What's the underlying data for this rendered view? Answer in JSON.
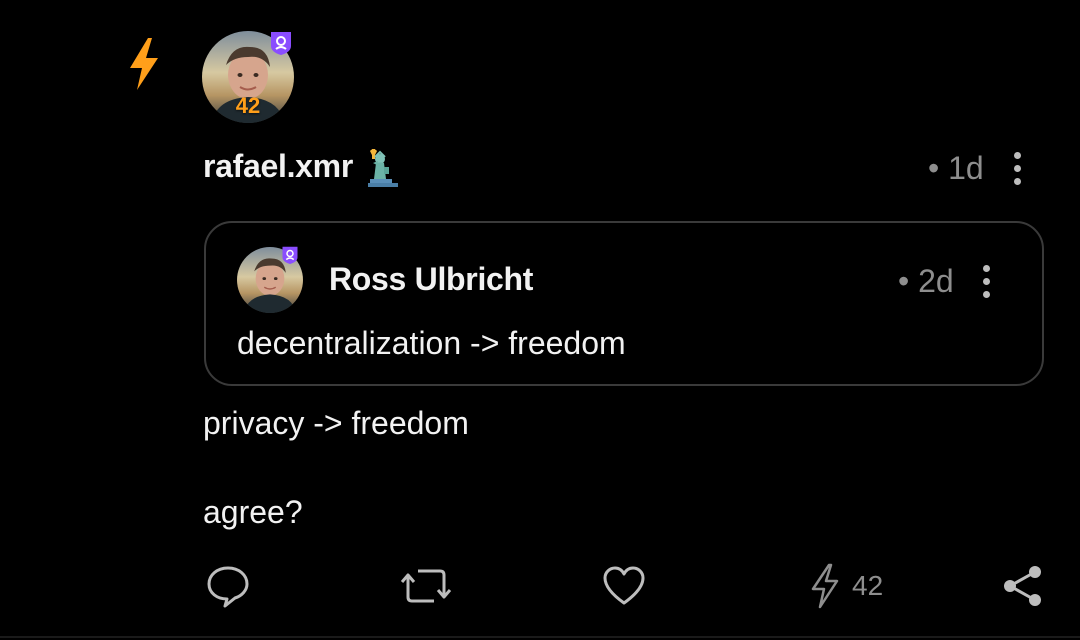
{
  "post": {
    "author": "rafael.xmr",
    "author_emoji": "statue-of-liberty",
    "time": "• 1d",
    "zap_total_badge": "42",
    "lines": [
      "privacy -> freedom",
      "agree?"
    ]
  },
  "quote": {
    "author": "Ross Ulbricht",
    "time": "• 2d",
    "text": "decentralization -> freedom"
  },
  "actions": {
    "reply_icon": "comment-icon",
    "repost_icon": "repost-icon",
    "like_icon": "heart-icon",
    "zap_icon": "lightning-icon",
    "zap_count": "42",
    "share_icon": "share-icon"
  },
  "colors": {
    "accent_zap": "#ff9f1a",
    "badge_purple": "#8a4dff",
    "icon_gray": "#bdbdbd",
    "muted_text": "#8e8e8e"
  }
}
